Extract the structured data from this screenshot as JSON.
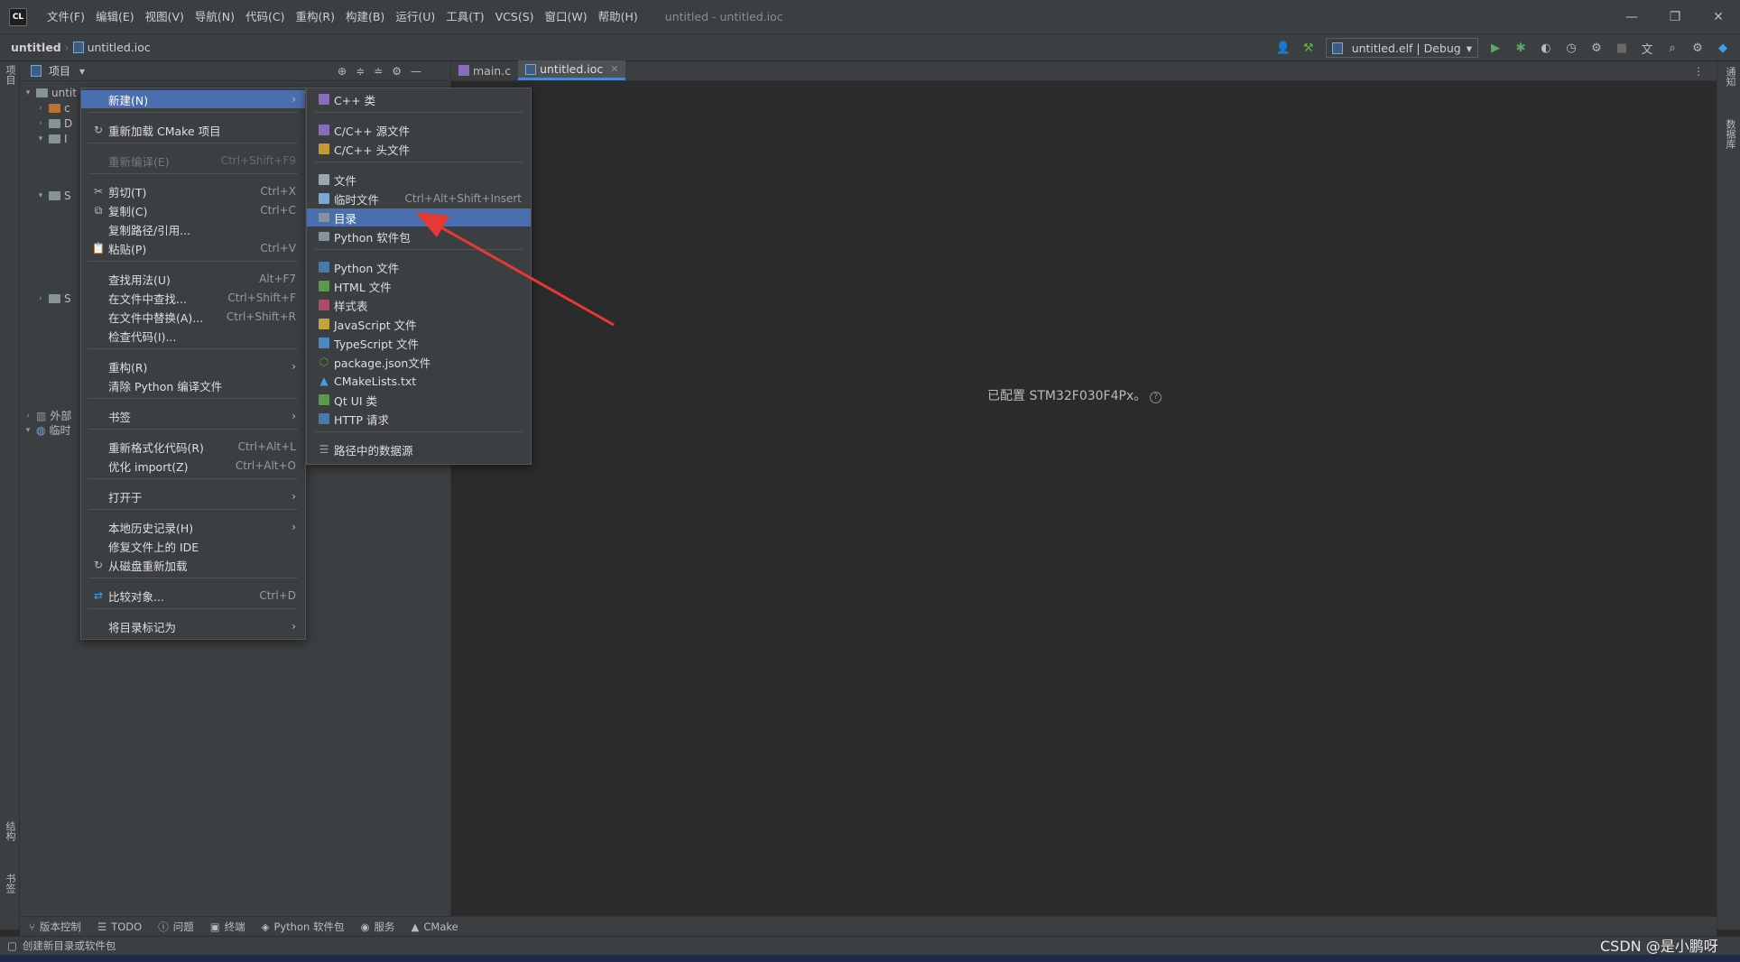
{
  "app": {
    "logo": "CL",
    "window_title": "untitled - untitled.ioc",
    "menu": [
      "文件(F)",
      "编辑(E)",
      "视图(V)",
      "导航(N)",
      "代码(C)",
      "重构(R)",
      "构建(B)",
      "运行(U)",
      "工具(T)",
      "VCS(S)",
      "窗口(W)",
      "帮助(H)"
    ]
  },
  "nav": {
    "project": "untitled",
    "file": "untitled.ioc",
    "run_config": "untitled.elf | Debug"
  },
  "panel": {
    "title": "项目",
    "tree_visible": [
      "untit",
      "c",
      "D",
      "I",
      "S",
      "S",
      "外部",
      "临时"
    ]
  },
  "tabs": [
    {
      "label": "main.c",
      "icon": "c-file-icon"
    },
    {
      "label": "untitled.ioc",
      "icon": "ioc-file-icon"
    }
  ],
  "editor": {
    "message": "已配置 STM32F030F4Px。"
  },
  "context_menu": {
    "items": [
      {
        "label": "新建(N)",
        "submenu": true
      },
      {
        "label": "重新加载 CMake 项目",
        "icon": "reload-icon"
      },
      {
        "label": "重新编译(E)",
        "shortcut": "Ctrl+Shift+F9",
        "disabled": true
      },
      {
        "label": "剪切(T)",
        "shortcut": "Ctrl+X",
        "icon": "cut-icon"
      },
      {
        "label": "复制(C)",
        "shortcut": "Ctrl+C",
        "icon": "copy-icon"
      },
      {
        "label": "复制路径/引用..."
      },
      {
        "label": "粘贴(P)",
        "shortcut": "Ctrl+V",
        "icon": "paste-icon"
      },
      {
        "label": "查找用法(U)",
        "shortcut": "Alt+F7"
      },
      {
        "label": "在文件中查找...",
        "shortcut": "Ctrl+Shift+F"
      },
      {
        "label": "在文件中替换(A)...",
        "shortcut": "Ctrl+Shift+R"
      },
      {
        "label": "检查代码(I)..."
      },
      {
        "label": "重构(R)",
        "submenu": true
      },
      {
        "label": "清除 Python 编译文件"
      },
      {
        "label": "书签",
        "submenu": true
      },
      {
        "label": "重新格式化代码(R)",
        "shortcut": "Ctrl+Alt+L"
      },
      {
        "label": "优化 import(Z)",
        "shortcut": "Ctrl+Alt+O"
      },
      {
        "label": "打开于",
        "submenu": true
      },
      {
        "label": "本地历史记录(H)",
        "submenu": true
      },
      {
        "label": "修复文件上的 IDE"
      },
      {
        "label": "从磁盘重新加载",
        "icon": "reload-icon"
      },
      {
        "label": "比较对象...",
        "shortcut": "Ctrl+D",
        "icon": "compare-icon"
      },
      {
        "label": "将目录标记为",
        "submenu": true
      }
    ]
  },
  "new_submenu": {
    "items": [
      {
        "label": "C++ 类",
        "icon": "cpp-class-icon"
      },
      {
        "label": "C/C++ 源文件",
        "icon": "c-source-icon"
      },
      {
        "label": "C/C++ 头文件",
        "icon": "c-header-icon"
      },
      {
        "label": "文件",
        "icon": "file-icon"
      },
      {
        "label": "临时文件",
        "shortcut": "Ctrl+Alt+Shift+Insert",
        "icon": "scratch-file-icon"
      },
      {
        "label": "目录",
        "icon": "folder-icon",
        "selected": true
      },
      {
        "label": "Python 软件包",
        "icon": "python-package-icon"
      },
      {
        "label": "Python 文件",
        "icon": "python-file-icon"
      },
      {
        "label": "HTML 文件",
        "icon": "html-file-icon"
      },
      {
        "label": "样式表",
        "icon": "css-file-icon"
      },
      {
        "label": "JavaScript 文件",
        "icon": "js-file-icon"
      },
      {
        "label": "TypeScript 文件",
        "icon": "ts-file-icon"
      },
      {
        "label": "package.json文件",
        "icon": "package-json-icon"
      },
      {
        "label": "CMakeLists.txt",
        "icon": "cmake-icon"
      },
      {
        "label": "Qt UI 类",
        "icon": "qt-ui-icon"
      },
      {
        "label": "HTTP 请求",
        "icon": "http-request-icon"
      },
      {
        "label": "路径中的数据源",
        "icon": "datasource-icon"
      }
    ]
  },
  "bottom_tools": [
    "版本控制",
    "TODO",
    "问题",
    "终端",
    "Python 软件包",
    "服务",
    "CMake"
  ],
  "status": "创建新目录或软件包",
  "left_strip": {
    "project": "项目",
    "structure": "结构",
    "bookmarks": "书签"
  },
  "right_strip": {
    "notifications": "通知",
    "database": "数据库"
  },
  "watermark": "CSDN @是小鹏呀",
  "colors": {
    "selection": "#4b6eaf",
    "arrow": "#e53935",
    "background": "#2b2b2b",
    "panel": "#3c3f41"
  }
}
